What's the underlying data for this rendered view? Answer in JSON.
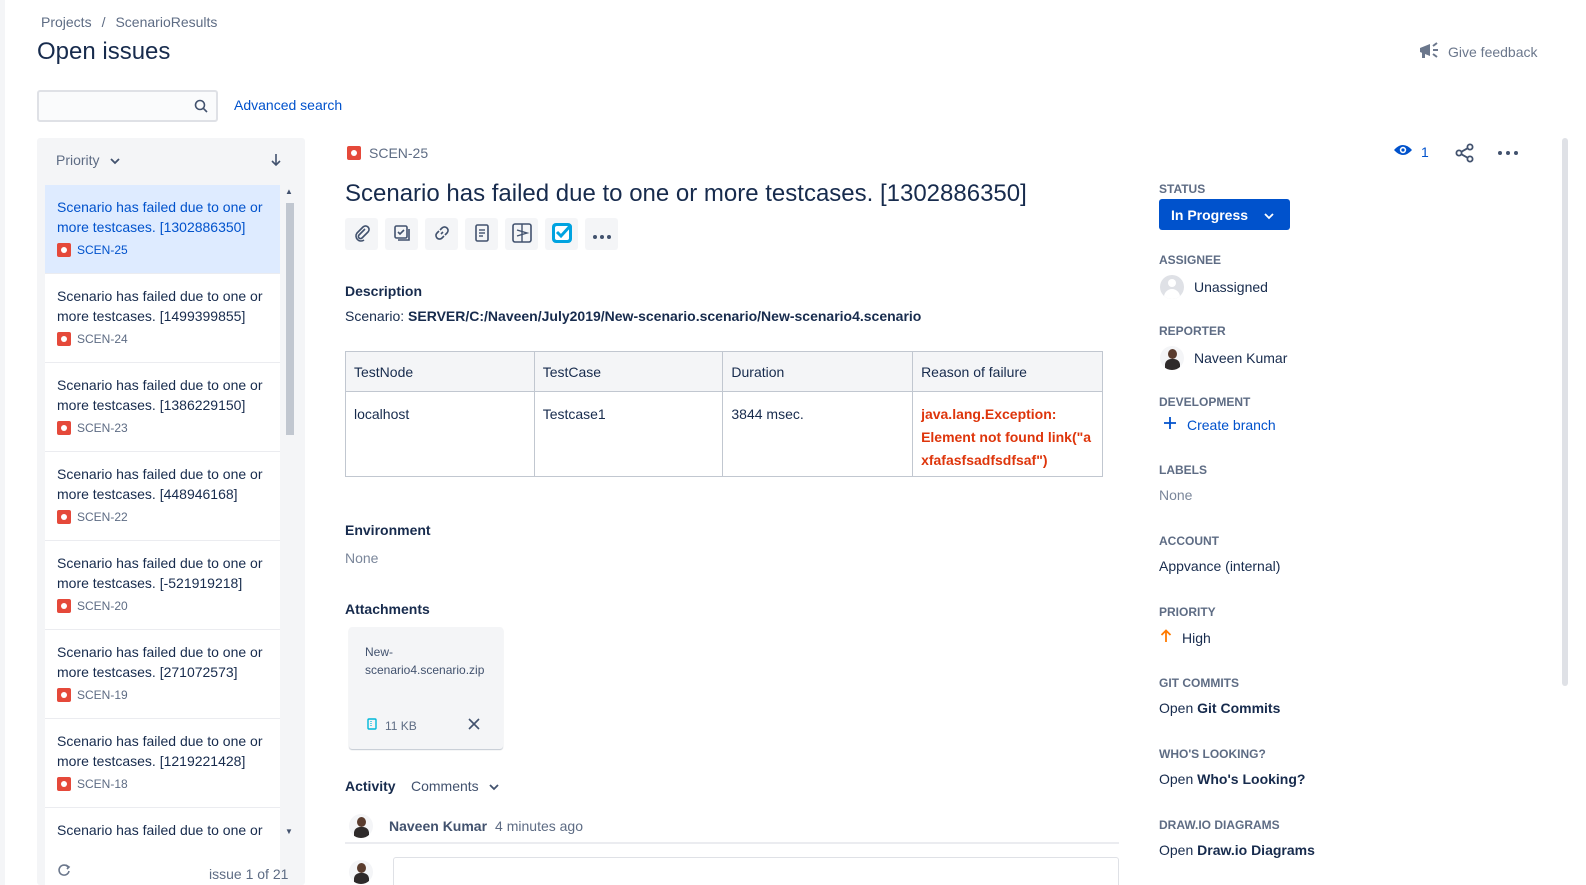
{
  "breadcrumb": {
    "projects": "Projects",
    "separator": "/",
    "current": "ScenarioResults"
  },
  "page_title": "Open issues",
  "feedback": {
    "label": "Give feedback"
  },
  "search": {
    "placeholder": "",
    "advanced": "Advanced search"
  },
  "list": {
    "sort_label": "Priority",
    "items": [
      {
        "summary": "Scenario has failed due to one or more testcases. [1302886350]",
        "key": "SCEN-25"
      },
      {
        "summary": "Scenario has failed due to one or more testcases. [1499399855]",
        "key": "SCEN-24"
      },
      {
        "summary": "Scenario has failed due to one or more testcases. [1386229150]",
        "key": "SCEN-23"
      },
      {
        "summary": "Scenario has failed due to one or more testcases. [448946168]",
        "key": "SCEN-22"
      },
      {
        "summary": "Scenario has failed due to one or more testcases. [-521919218]",
        "key": "SCEN-20"
      },
      {
        "summary": "Scenario has failed due to one or more testcases. [271072573]",
        "key": "SCEN-19"
      },
      {
        "summary": "Scenario has failed due to one or more testcases. [1219221428]",
        "key": "SCEN-18"
      },
      {
        "summary": "Scenario has failed due to one or",
        "key": ""
      }
    ],
    "footer_count": "issue 1 of 21"
  },
  "issue": {
    "key": "SCEN-25",
    "title": "Scenario has failed due to one or more testcases. [1302886350]",
    "watch_count": "1",
    "description_label": "Description",
    "scenario_prefix": "Scenario: ",
    "scenario_path": "SERVER/C:/Naveen/July2019/New-scenario.scenario/New-scenario4.scenario",
    "table": {
      "headers": [
        "TestNode",
        "TestCase",
        "Duration",
        "Reason of failure"
      ],
      "row": {
        "node": "localhost",
        "testcase": "Testcase1",
        "duration": "3844 msec.",
        "failure_line1": "java.lang.Exception:",
        "failure_line2": "Element not found link(\"a",
        "failure_line3": "xfafasfsadfsdfsaf\")"
      }
    },
    "environment_label": "Environment",
    "environment_value": "None",
    "attachments_label": "Attachments",
    "attachment": {
      "name_line1": "New-",
      "name_line2": "scenario4.scenario.zip",
      "size": "11 KB"
    },
    "activity_label": "Activity",
    "activity_filter": "Comments",
    "comment": {
      "author": "Naveen Kumar",
      "time": "4 minutes ago"
    }
  },
  "sidebar": {
    "status_label": "STATUS",
    "status_value": "In Progress",
    "assignee_label": "ASSIGNEE",
    "assignee_value": "Unassigned",
    "reporter_label": "REPORTER",
    "reporter_value": "Naveen Kumar",
    "development_label": "DEVELOPMENT",
    "development_value": "Create branch",
    "labels_label": "LABELS",
    "labels_value": "None",
    "account_label": "ACCOUNT",
    "account_value": "Appvance (internal)",
    "priority_label": "PRIORITY",
    "priority_value": "High",
    "git_label": "GIT COMMITS",
    "git_open": "Open",
    "git_value": "Git Commits",
    "whos_label": "WHO'S LOOKING?",
    "whos_open": "Open",
    "whos_value": "Who's Looking?",
    "drawio_label": "DRAW.IO DIAGRAMS",
    "drawio_open": "Open",
    "drawio_value": "Draw.io Diagrams"
  },
  "colors": {
    "accent": "#0052cc",
    "bug": "#e5493a",
    "failure": "#de350b",
    "priority_high": "#ff7a00"
  },
  "icons": [
    "search-icon",
    "megaphone-icon",
    "chevron-down-icon",
    "sort-arrow-icon",
    "bug-icon",
    "eye-icon",
    "share-icon",
    "more-icon",
    "paperclip-icon",
    "checklist-icon",
    "link-icon",
    "document-icon",
    "diagram-icon",
    "checkbox-icon",
    "file-icon",
    "close-icon",
    "plus-icon",
    "arrow-up-icon",
    "refresh-icon"
  ]
}
